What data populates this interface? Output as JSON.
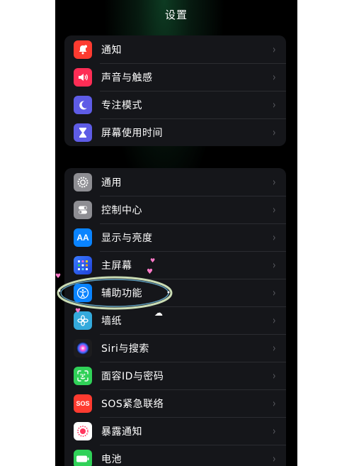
{
  "header": {
    "title": "设置"
  },
  "group1": [
    {
      "label": "通知",
      "icon": "bell-icon",
      "color": "#fe3b30"
    },
    {
      "label": "声音与触感",
      "icon": "speaker-icon",
      "color": "#fe2d55"
    },
    {
      "label": "专注模式",
      "icon": "moon-icon",
      "color": "#5e5ce6"
    },
    {
      "label": "屏幕使用时间",
      "icon": "hourglass-icon",
      "color": "#5e5ce6"
    }
  ],
  "group2": [
    {
      "label": "通用",
      "icon": "gear-icon",
      "color": "#8e8e93"
    },
    {
      "label": "控制中心",
      "icon": "toggles-icon",
      "color": "#8e8e93"
    },
    {
      "label": "显示与亮度",
      "icon": "text-size-icon",
      "icon_text": "AA",
      "color": "#0a84ff"
    },
    {
      "label": "主屏幕",
      "icon": "home-grid-icon",
      "color": "#2f6bff"
    },
    {
      "label": "辅助功能",
      "icon": "accessibility-icon",
      "color": "#0a84ff"
    },
    {
      "label": "墙纸",
      "icon": "flower-icon",
      "color": "#34aadc"
    },
    {
      "label": "Siri与搜索",
      "icon": "siri-icon",
      "color": "#1c1c1e"
    },
    {
      "label": "面容ID与密码",
      "icon": "face-id-icon",
      "color": "#30d158"
    },
    {
      "label": "SOS紧急联络",
      "icon": "sos-icon",
      "icon_text": "SOS",
      "color": "#fe3b30"
    },
    {
      "label": "暴露通知",
      "icon": "exposure-icon",
      "color": "#ffffff"
    },
    {
      "label": "电池",
      "icon": "battery-icon",
      "color": "#30d158"
    }
  ],
  "chevron": "›"
}
